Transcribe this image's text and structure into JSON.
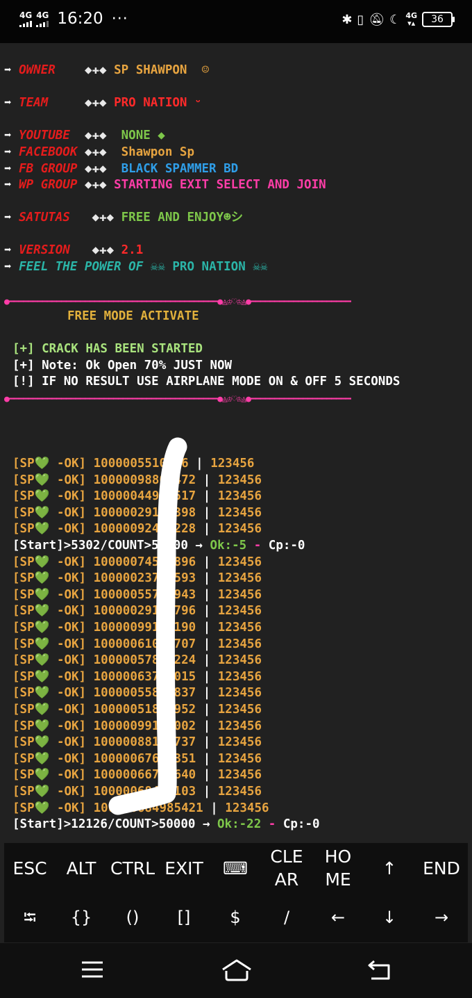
{
  "status_bar": {
    "signal_1": "4G",
    "signal_2": "4G",
    "time": "16:20",
    "more": "···",
    "net_label": "4G",
    "battery": "36"
  },
  "terminal": {
    "arrow": "➡",
    "owner": {
      "label": "OWNER",
      "sep": "◆✚◆",
      "value": "SP SHAWPON",
      "emoji": "☺"
    },
    "team": {
      "label": "TEAM",
      "sep": "◆✚◆",
      "value": "PRO NATION",
      "emoji": "ᵕ"
    },
    "youtube": {
      "label": "YOUTUBE",
      "sep": "◆✚◆",
      "value": "NONE ◆"
    },
    "facebook": {
      "label": "FACEBOOK",
      "sep": "◆✚◆",
      "value": "Shawpon Sp"
    },
    "fb_group": {
      "label": "FB GROUP",
      "sep": "◆✚◆",
      "value": "BLACK SPAMMER BD"
    },
    "wp_group": {
      "label": "WP GROUP",
      "sep": "◆✚◆",
      "value": "STARTING EXIT SELECT AND JOIN"
    },
    "status": {
      "label": "SATUTAS",
      "sep": "◆✚◆",
      "value": "FREE AND ENJOY☻シ"
    },
    "version": {
      "label": "VERSION",
      "sep": "◆✚◆",
      "value": "2.1"
    },
    "feel": {
      "text": "FEEL THE POWER OF",
      "deco": "☠☠",
      "value": "PRO NATION"
    },
    "divider": "●━━━━━━━━━━━━━━━━━━━━━━━━━━━━━━━━━━━━━━━━━━━━●◬♔♡♔◬●━━━━━━━━━━━━━━━━━━━━━━━━━━━━━━━━━━━━━━━━●",
    "free_mode": "FREE MODE ACTIVATE",
    "crack_started": "[+] CRACK HAS BEEN STARTED",
    "note": "[+] Note: Ok Open 70% JUST NOW",
    "airplane": "[!] IF NO RESULT USE AIRPLANE MODE ON & OFF 5 SECONDS",
    "ok_prefix": "[SP",
    "ok_heart": "💚",
    "ok_suffix": " -OK]",
    "pipe": " | ",
    "password": "123456",
    "results_a": [
      "1000005510546",
      "10000098806472",
      "10000044904517",
      "10000029134398",
      "10000092461228"
    ],
    "progress_1": {
      "start": "[Start]>5302/COUNT>50000",
      "arrow": " → ",
      "ok": "Ok:-5",
      "dash": " - ",
      "cp": "Cp:-0"
    },
    "results_b": [
      "10000074528896",
      "10000023760593",
      "10000055712943",
      "10000029147796",
      "10000099118190",
      "10000061067707",
      "10000057830224",
      "10000063799015",
      "10000055893837",
      "10000051854952",
      "10000099160002",
      "10000088171737",
      "10000067608351",
      "10000066786640",
      "10000068478103",
      "100000684985421"
    ],
    "progress_2": {
      "start": "[Start]>12126/COUNT>50000",
      "arrow": " → ",
      "ok": "Ok:-22",
      "dash": " - ",
      "cp": "Cp:-0"
    }
  },
  "extra_keys": {
    "row1": [
      "ESC",
      "ALT",
      "CTRL",
      "EXIT",
      "⌨",
      "CLEAR",
      "HOME",
      "↑",
      "END"
    ],
    "row2": [
      "⭾",
      "{}",
      "()",
      "[]",
      "$",
      "/",
      "←",
      "↓",
      "→"
    ]
  },
  "nav": {
    "menu": "menu-icon",
    "home": "home-icon",
    "back": "back-icon"
  }
}
